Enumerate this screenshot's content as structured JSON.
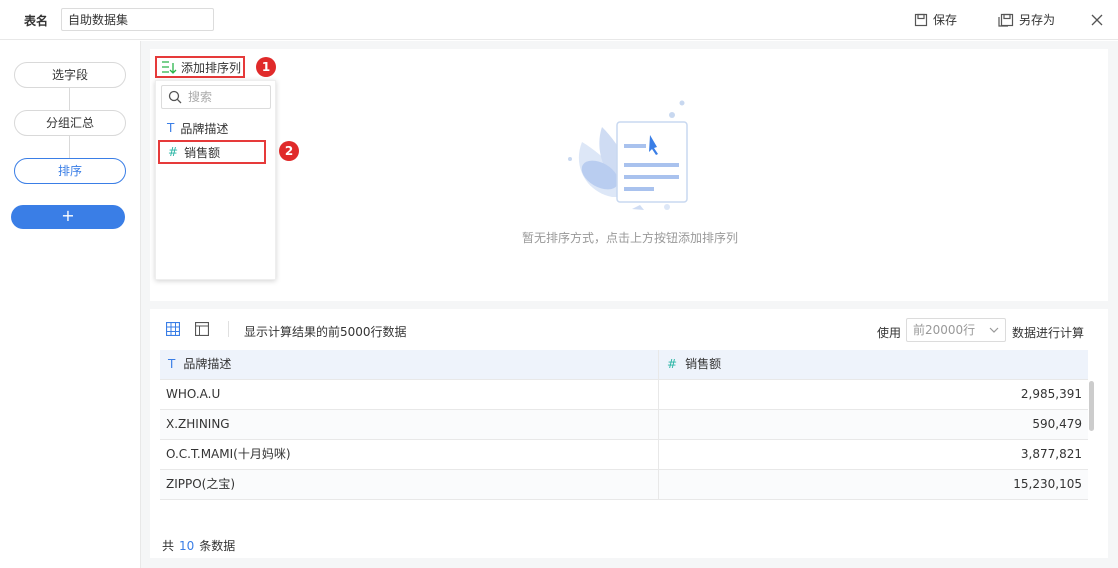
{
  "header": {
    "table_name_label": "表名",
    "table_name_value": "自助数据集",
    "save_label": "保存",
    "save_as_label": "另存为"
  },
  "pipeline": {
    "steps": [
      "选字段",
      "分组汇总",
      "排序"
    ],
    "active_step": "排序",
    "add_label": "+"
  },
  "sort": {
    "add_sort_label": "添加排序列",
    "badge_1": "1",
    "badge_2": "2",
    "search_placeholder": "搜索",
    "fields": [
      {
        "type_icon": "T",
        "label": "品牌描述"
      },
      {
        "type_icon": "#",
        "label": "销售额"
      }
    ],
    "empty_text": "暂无排序方式，点击上方按钮添加排序列"
  },
  "preview": {
    "note": "显示计算结果的前5000行数据",
    "use_label": "使用",
    "rows_option": "前20000行",
    "calc_label": "数据进行计算",
    "columns": [
      {
        "type_icon": "T",
        "label": "品牌描述"
      },
      {
        "type_icon": "#",
        "label": "销售额"
      }
    ],
    "rows": [
      [
        "WHO.A.U",
        "2,985,391"
      ],
      [
        "X.ZHINING",
        "590,479"
      ],
      [
        "O.C.T.MAMI(十月妈咪)",
        "3,877,821"
      ],
      [
        "ZIPPO(之宝)",
        "15,230,105"
      ]
    ],
    "count_prefix": "共",
    "count_value": "10",
    "count_suffix": "条数据"
  },
  "colors": {
    "accent": "#3a7ee6",
    "highlight_red": "#e63a3a",
    "number_type": "#2ab5a5"
  }
}
